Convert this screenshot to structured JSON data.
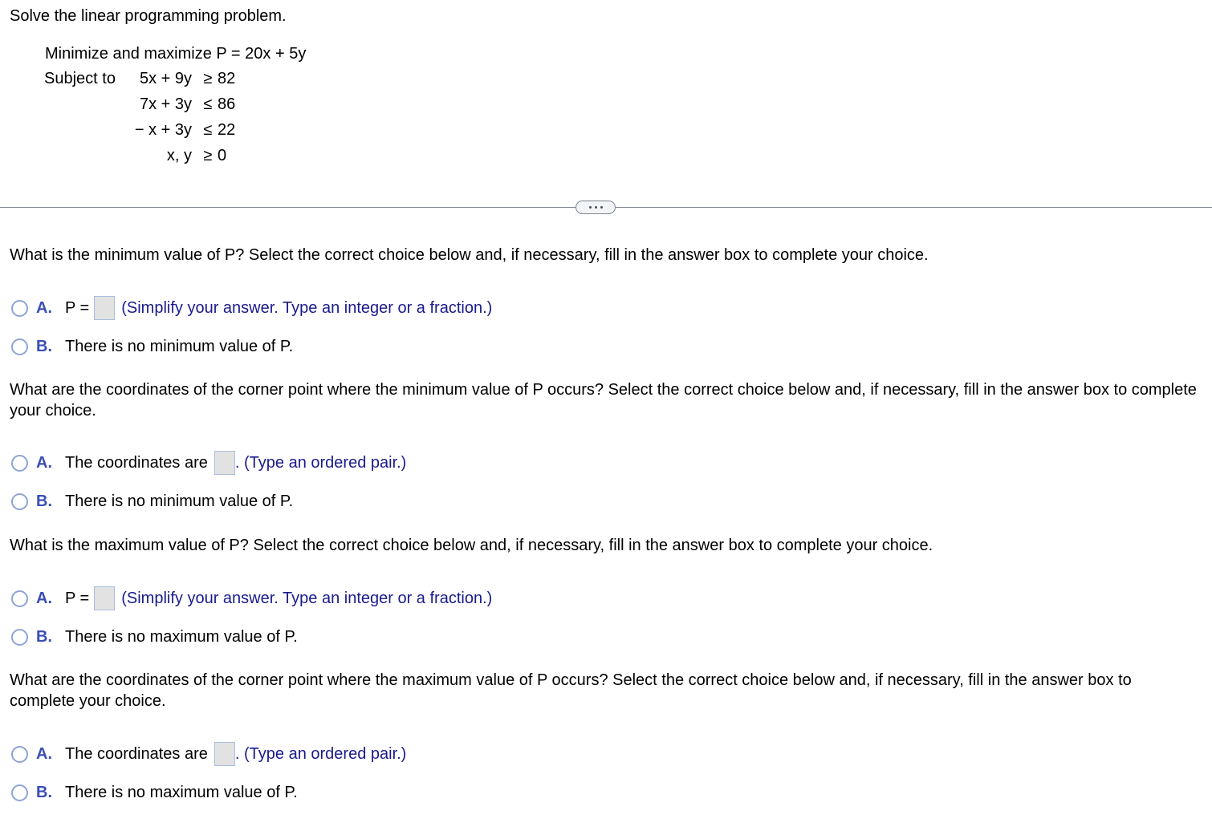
{
  "problem": {
    "intro": "Solve the linear programming problem.",
    "objective": "Minimize and maximize P = 20x + 5y",
    "subject_to_label": "Subject to",
    "constraints": [
      {
        "lhs": "5x + 9y",
        "rel": "≥",
        "rhs": "82"
      },
      {
        "lhs": "7x + 3y",
        "rel": "≤",
        "rhs": "86"
      },
      {
        "lhs": "− x + 3y",
        "rel": "≤",
        "rhs": "22"
      },
      {
        "lhs": "x, y",
        "rel": "≥",
        "rhs": "0"
      }
    ]
  },
  "more_button": {
    "icon": "ellipsis-icon"
  },
  "questions": [
    {
      "prompt": "What is the minimum value of P? Select the correct choice below and, if necessary, fill in the answer box to complete your choice.",
      "choice_a": {
        "letter": "A.",
        "prefix": "P =",
        "value": "",
        "hint": "(Simplify your answer. Type an integer or a fraction.)"
      },
      "choice_b": {
        "letter": "B.",
        "text": "There is no minimum value of P."
      }
    },
    {
      "prompt": "What are the coordinates of the corner point where the minimum value of P occurs? Select the correct choice below and, if necessary, fill in the answer box to complete your choice.",
      "choice_a": {
        "letter": "A.",
        "prefix": "The coordinates are",
        "value": "",
        "hint": ". (Type an ordered pair.)"
      },
      "choice_b": {
        "letter": "B.",
        "text": "There is no minimum value of P."
      }
    },
    {
      "prompt": "What is the maximum value of P? Select the correct choice below and, if necessary, fill in the answer box to complete your choice.",
      "choice_a": {
        "letter": "A.",
        "prefix": "P =",
        "value": "",
        "hint": "(Simplify your answer. Type an integer or a fraction.)"
      },
      "choice_b": {
        "letter": "B.",
        "text": "There is no maximum value of P."
      }
    },
    {
      "prompt": "What are the coordinates of the corner point where the maximum value of P occurs? Select the correct choice below and, if necessary, fill in the answer box to complete your choice.",
      "choice_a": {
        "letter": "A.",
        "prefix": "The coordinates are",
        "value": "",
        "hint": ". (Type an ordered pair.)"
      },
      "choice_b": {
        "letter": "B.",
        "text": "There is no maximum value of P."
      }
    }
  ]
}
